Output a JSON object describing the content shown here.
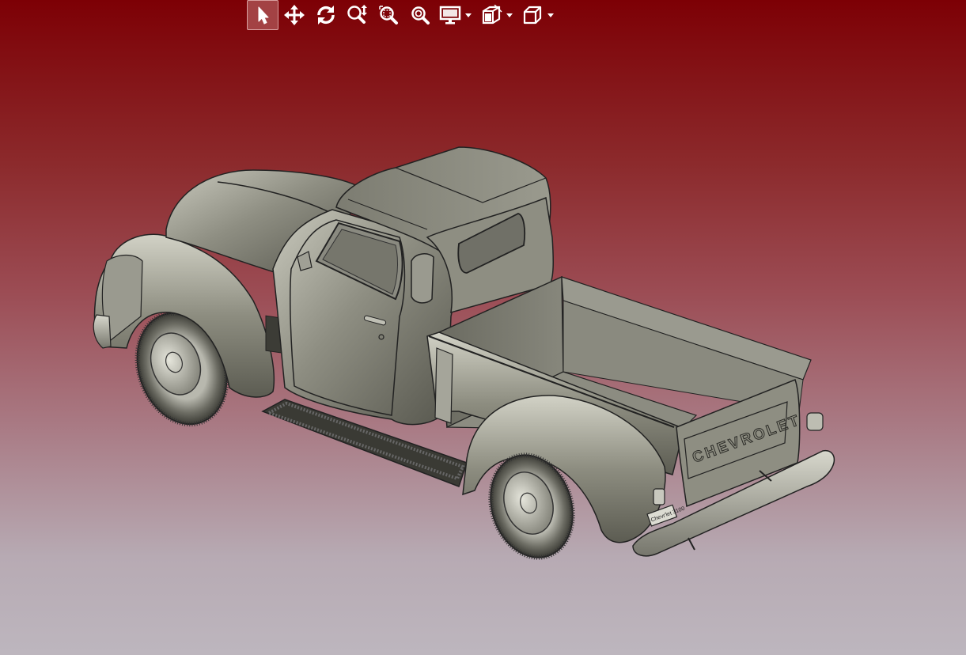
{
  "toolbar": {
    "tools": [
      {
        "name": "select-icon",
        "active": true
      },
      {
        "name": "pan-icon",
        "active": false
      },
      {
        "name": "rotate-icon",
        "active": false
      },
      {
        "name": "zoom-icon",
        "active": false
      },
      {
        "name": "zoom-window-icon",
        "active": false
      },
      {
        "name": "zoom-fit-icon",
        "active": false
      }
    ],
    "dropdowns": [
      {
        "name": "display-mode-icon"
      },
      {
        "name": "section-view-icon"
      },
      {
        "name": "view-orientation-icon"
      }
    ]
  },
  "viewport": {
    "background_top": "#7d0005",
    "background_bottom": "#bdb6be"
  },
  "model": {
    "tailgate_lettering": "CHEVROLET",
    "license_plate_text": "Chevr'let 3100"
  }
}
